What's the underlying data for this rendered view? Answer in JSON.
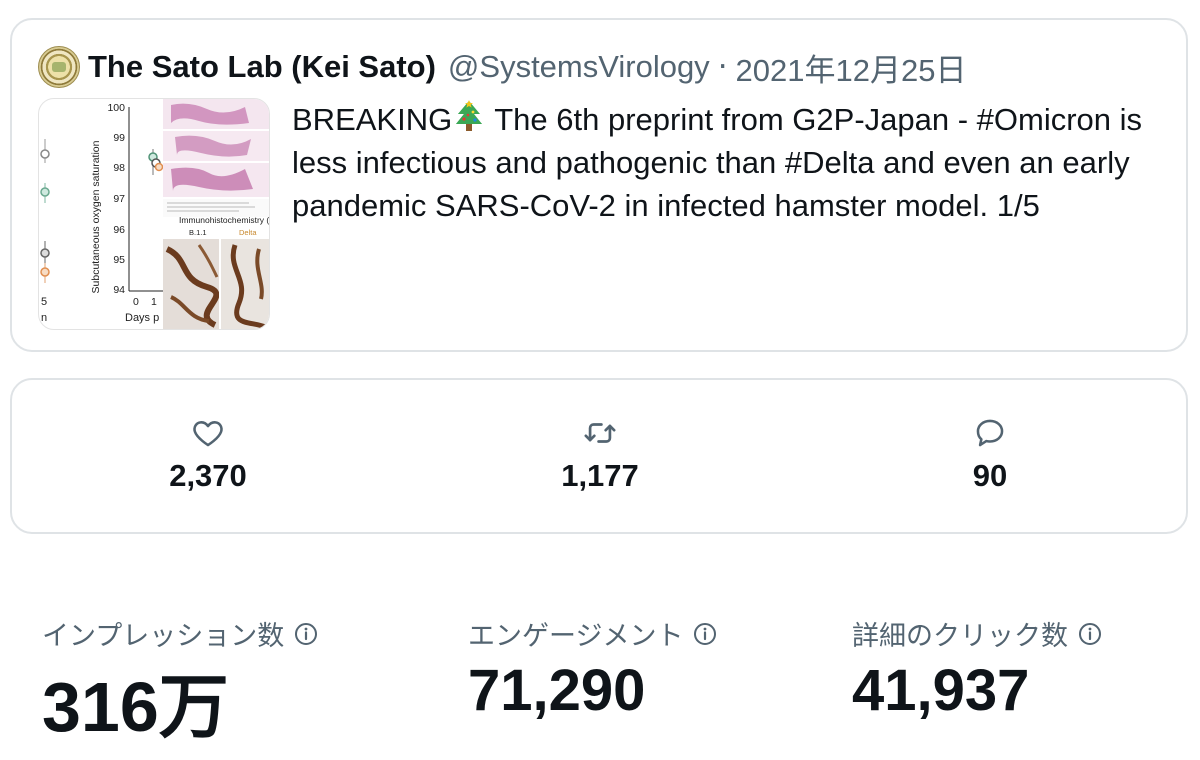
{
  "tweet": {
    "display_name": "The Sato Lab (Kei Sato)",
    "handle": "@SystemsVirology",
    "separator": "·",
    "date": "2021年12月25日",
    "text_before_emoji": "BREAKING",
    "emoji": "christmas-tree",
    "text_after_emoji": "The 6th preprint from G2P-Japan - #Omicron is less infectious and pathogenic than #Delta and even an early pandemic SARS-CoV-2 in infected hamster model. 1/5",
    "thumbnail": {
      "ylabel": "Subcutaneous oxygen saturation",
      "yticks": [
        "100",
        "99",
        "98",
        "97",
        "96",
        "95",
        "94"
      ],
      "xticks": [
        "0",
        "1"
      ],
      "xlabel": "Days p",
      "left_edge_labels": [
        "5",
        "n"
      ],
      "caption": "Immunohistochemistry (SARS",
      "panel_label_left": "B.1.1",
      "panel_label_right": "Delta"
    }
  },
  "engagement": {
    "likes": "2,370",
    "retweets": "1,177",
    "replies": "90"
  },
  "analytics": {
    "impressions": {
      "label": "インプレッション数",
      "value": "316万"
    },
    "engagements": {
      "label": "エンゲージメント",
      "value": "71,290"
    },
    "detail_clicks": {
      "label": "詳細のクリック数",
      "value": "41,937"
    }
  },
  "colors": {
    "text": "#0f1419",
    "secondary": "#536471",
    "border": "#dfe3e6"
  }
}
